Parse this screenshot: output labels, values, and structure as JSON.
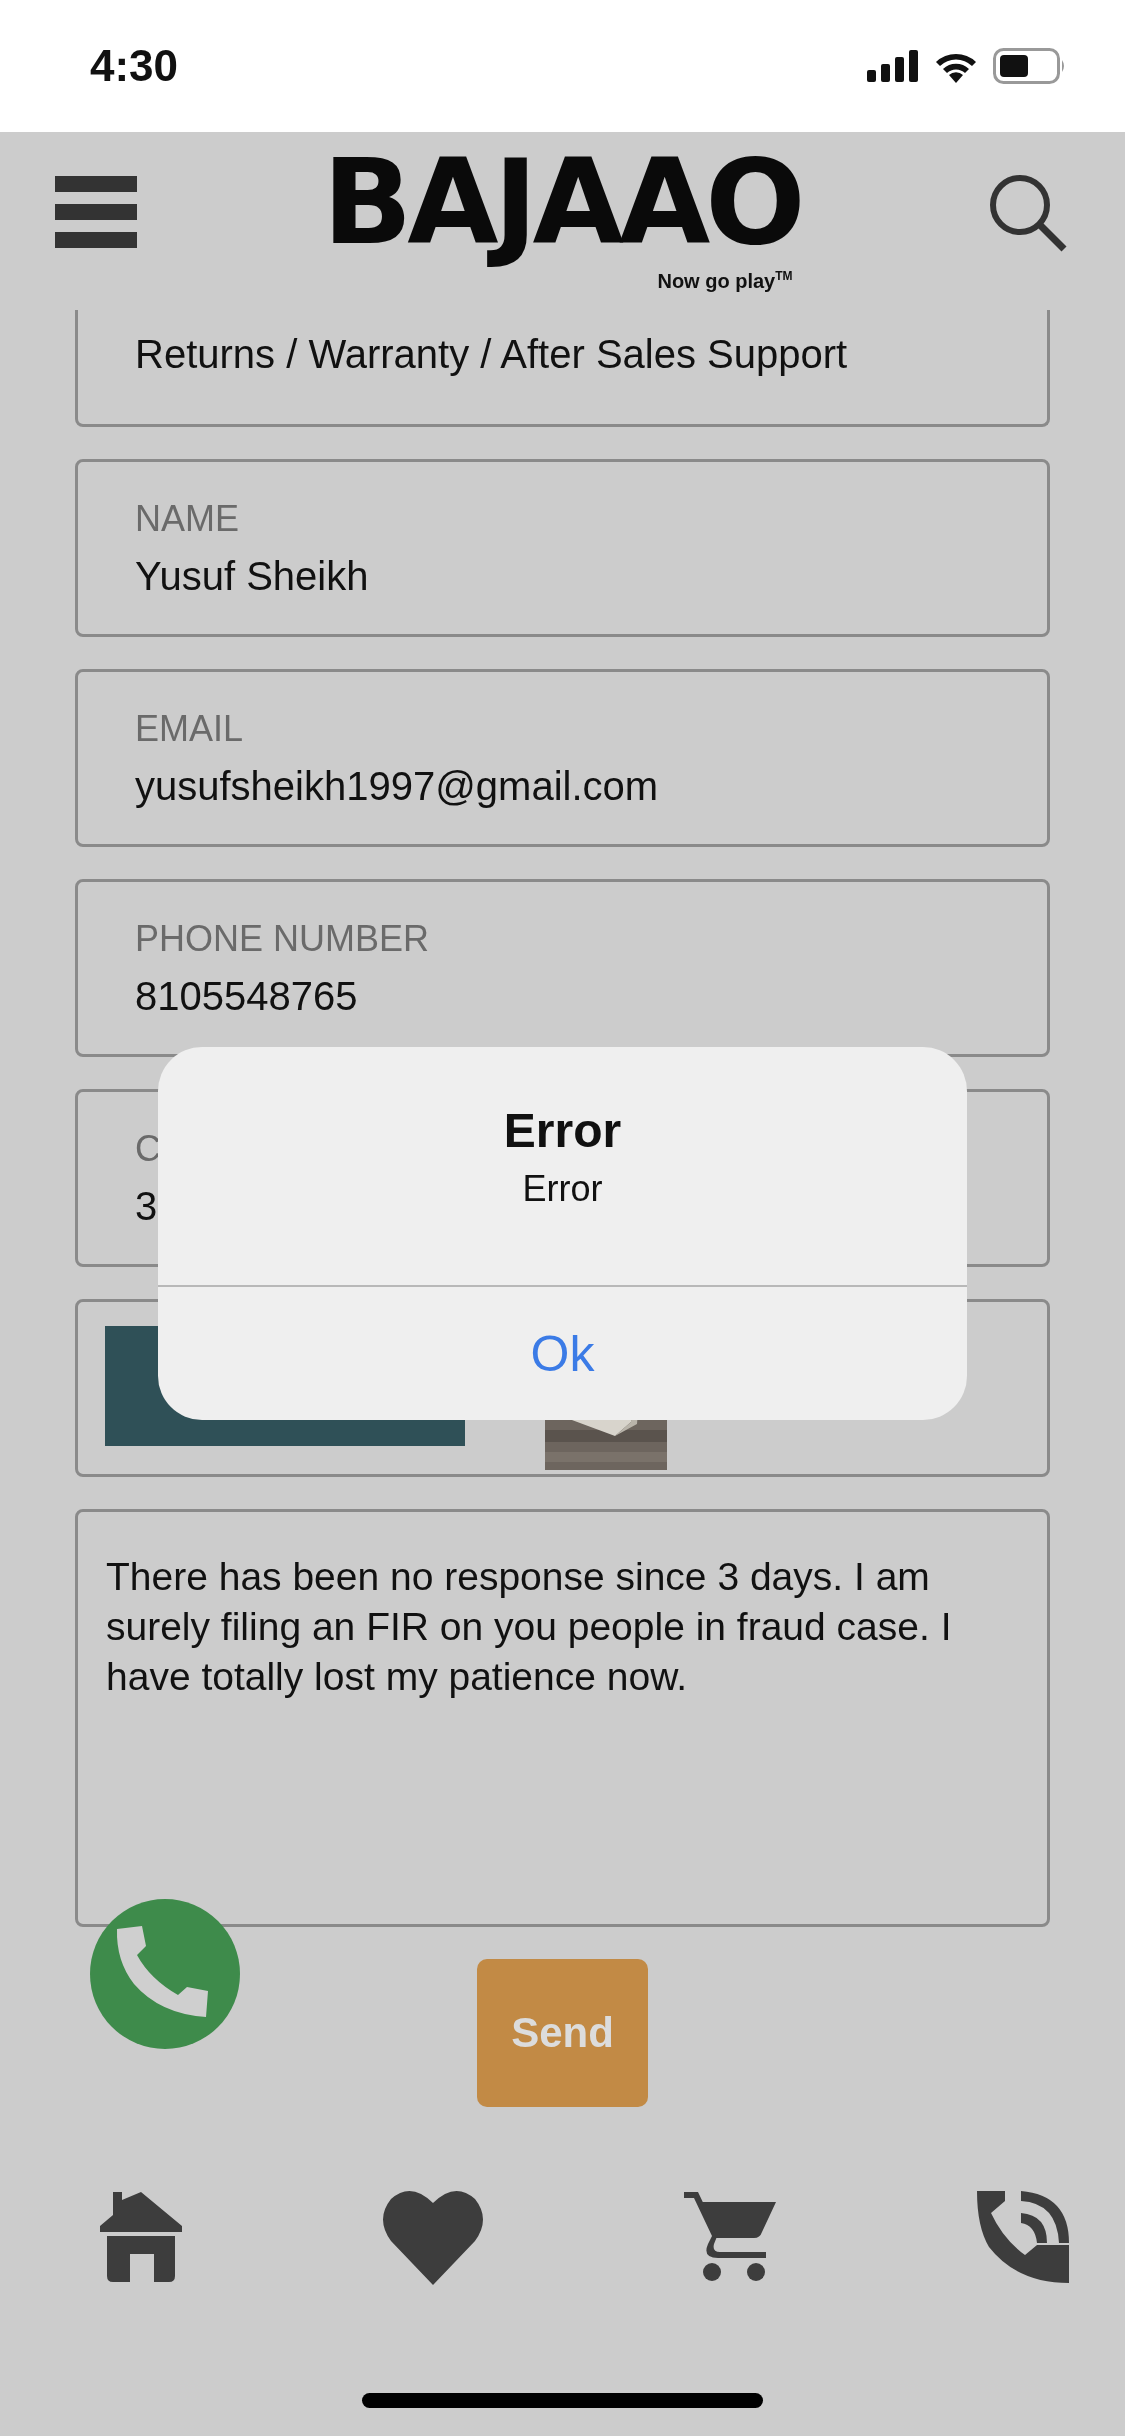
{
  "status_bar": {
    "time": "4:30"
  },
  "header": {
    "logo": "BAJAAO",
    "tagline": "Now go play$^{TM}$"
  },
  "fields": [
    {
      "kind": "cut",
      "value": "Returns / Warranty / After Sales Support"
    },
    {
      "kind": "text",
      "label": "NAME",
      "value": "Yusuf Sheikh"
    },
    {
      "kind": "text",
      "label": "EMAIL",
      "value": "yusufsheikh1997@gmail.com"
    },
    {
      "kind": "text",
      "label": "PHONE NUMBER",
      "value": "8105548765"
    },
    {
      "kind": "text",
      "label": "C",
      "value": "3"
    }
  ],
  "message": "There has been no response since 3 days. I am surely filing an FIR on you people in fraud case. I have totally lost my patience now.",
  "send_button": "Send",
  "dialog": {
    "title": "Error",
    "message": "Error",
    "button": "Ok"
  }
}
